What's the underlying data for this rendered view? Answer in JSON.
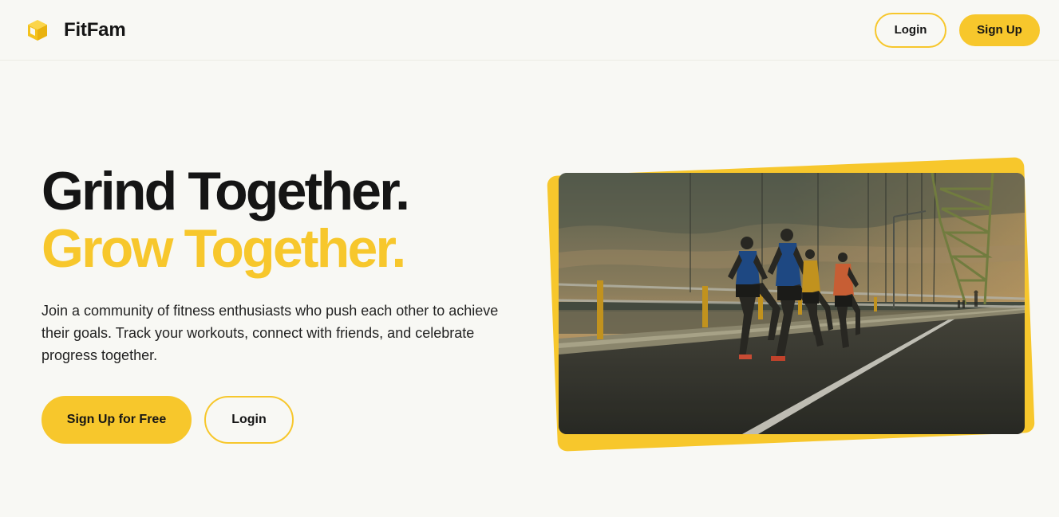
{
  "header": {
    "brand_name": "FitFam",
    "login_label": "Login",
    "signup_label": "Sign Up"
  },
  "hero": {
    "headline_line1": "Grind Together.",
    "headline_line2": "Grow Together.",
    "description": "Join a community of fitness enthusiasts who push each other to achieve their goals. Track your workouts, connect with friends, and celebrate progress together.",
    "cta_signup_label": "Sign Up for Free",
    "cta_login_label": "Login"
  },
  "colors": {
    "accent": "#f7c72c",
    "background": "#f8f8f4",
    "text": "#151515"
  },
  "icons": {
    "logo": "cube-icon"
  }
}
